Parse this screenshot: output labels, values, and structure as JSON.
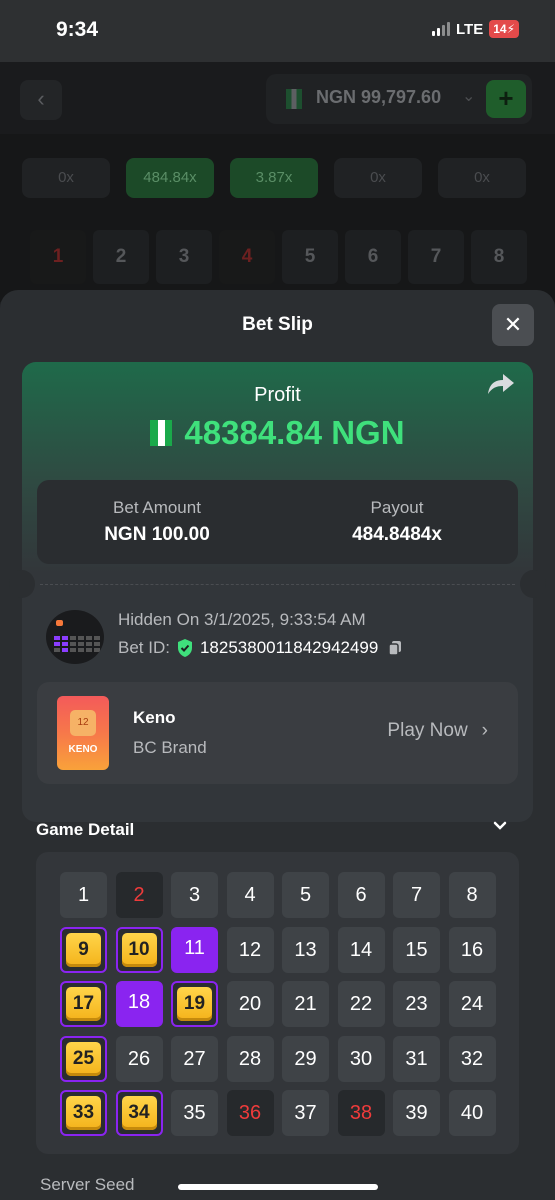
{
  "status_bar": {
    "time": "9:34",
    "network": "LTE",
    "battery": "14"
  },
  "background": {
    "balance": "NGN 99,797.60",
    "multipliers": [
      "0x",
      "484.84x",
      "3.87x",
      "0x",
      "0x"
    ],
    "numbers": [
      "1",
      "2",
      "3",
      "4",
      "5",
      "6",
      "7",
      "8"
    ]
  },
  "sheet": {
    "title": "Bet Slip",
    "close_icon": "close-icon",
    "profit_label": "Profit",
    "profit_value": "48384.84 NGN",
    "bet_amount_label": "Bet Amount",
    "bet_amount_value": "NGN 100.00",
    "payout_label": "Payout",
    "payout_value": "484.8484x",
    "hidden_on": "Hidden On 3/1/2025, 9:33:54 AM",
    "bet_id_label": "Bet ID:",
    "bet_id": "1825380011842942499",
    "game_name": "Keno",
    "game_brand": "BC Brand",
    "thumb_number": "12",
    "thumb_label": "KENO",
    "play_now": "Play Now",
    "game_detail_label": "Game Detail",
    "server_seed_label": "Server Seed"
  },
  "colors": {
    "accent_green": "#3fe07c",
    "pick_purple": "#8a24f0",
    "miss_red": "#ee3b3b",
    "hit_gold": "#f4b21a"
  },
  "board": {
    "numbers": [
      "1",
      "2",
      "3",
      "4",
      "5",
      "6",
      "7",
      "8",
      "9",
      "10",
      "11",
      "12",
      "13",
      "14",
      "15",
      "16",
      "17",
      "18",
      "19",
      "20",
      "21",
      "22",
      "23",
      "24",
      "25",
      "26",
      "27",
      "28",
      "29",
      "30",
      "31",
      "32",
      "33",
      "34",
      "35",
      "36",
      "37",
      "38",
      "39",
      "40"
    ],
    "states": [
      "normal",
      "red",
      "normal",
      "normal",
      "normal",
      "normal",
      "normal",
      "normal",
      "hit",
      "hit",
      "pick",
      "normal",
      "normal",
      "normal",
      "normal",
      "normal",
      "hit",
      "pick",
      "hit",
      "normal",
      "normal",
      "normal",
      "normal",
      "normal",
      "hit",
      "normal",
      "normal",
      "normal",
      "normal",
      "normal",
      "normal",
      "normal",
      "hit",
      "hit",
      "normal",
      "red",
      "normal",
      "red",
      "normal",
      "normal"
    ]
  }
}
